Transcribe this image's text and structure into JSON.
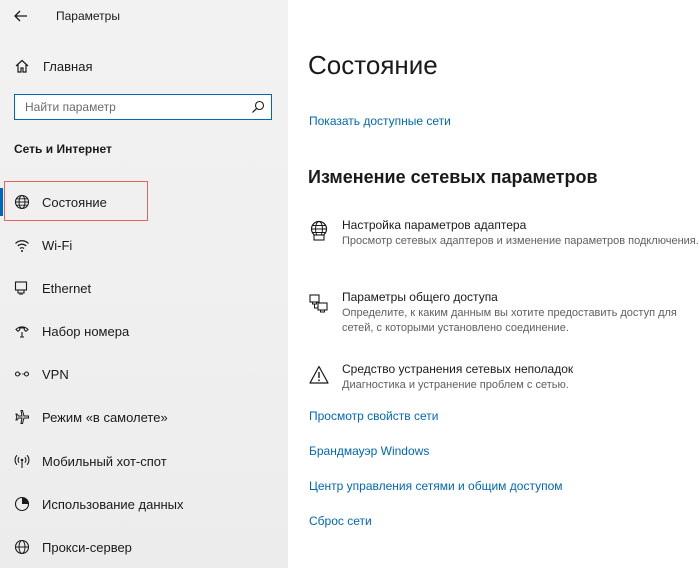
{
  "window": {
    "title": "Параметры"
  },
  "sidebar": {
    "home_label": "Главная",
    "search": {
      "placeholder": "Найти параметр",
      "value": ""
    },
    "section_title": "Сеть и Интернет",
    "items": [
      {
        "label": "Состояние",
        "icon": "globe-icon",
        "selected": true
      },
      {
        "label": "Wi-Fi",
        "icon": "wifi-icon"
      },
      {
        "label": "Ethernet",
        "icon": "ethernet-icon"
      },
      {
        "label": "Набор номера",
        "icon": "dialup-icon"
      },
      {
        "label": "VPN",
        "icon": "vpn-icon"
      },
      {
        "label": "Режим «в самолете»",
        "icon": "airplane-icon"
      },
      {
        "label": "Мобильный хот-спот",
        "icon": "hotspot-icon"
      },
      {
        "label": "Использование данных",
        "icon": "data-usage-icon"
      },
      {
        "label": "Прокси-сервер",
        "icon": "proxy-icon"
      }
    ]
  },
  "main": {
    "title": "Состояние",
    "show_networks_link": "Показать доступные сети",
    "change_section_title": "Изменение сетевых параметров",
    "settings": [
      {
        "title": "Настройка параметров адаптера",
        "desc": "Просмотр сетевых адаптеров и изменение параметров подключения.",
        "icon": "adapter-icon"
      },
      {
        "title": "Параметры общего доступа",
        "desc": "Определите, к каким данным вы хотите предоставить доступ для сетей, с которыми установлено соединение.",
        "icon": "sharing-icon"
      },
      {
        "title": "Средство устранения сетевых неполадок",
        "desc": "Диагностика и устранение проблем с сетью.",
        "icon": "warning-icon"
      }
    ],
    "links": [
      "Просмотр свойств сети",
      "Брандмауэр Windows",
      "Центр управления сетями и общим доступом",
      "Сброс сети"
    ]
  },
  "colors": {
    "accent": "#0067b8",
    "highlight": "#e0665a",
    "sidebar_bg": "#f2f2f2"
  }
}
